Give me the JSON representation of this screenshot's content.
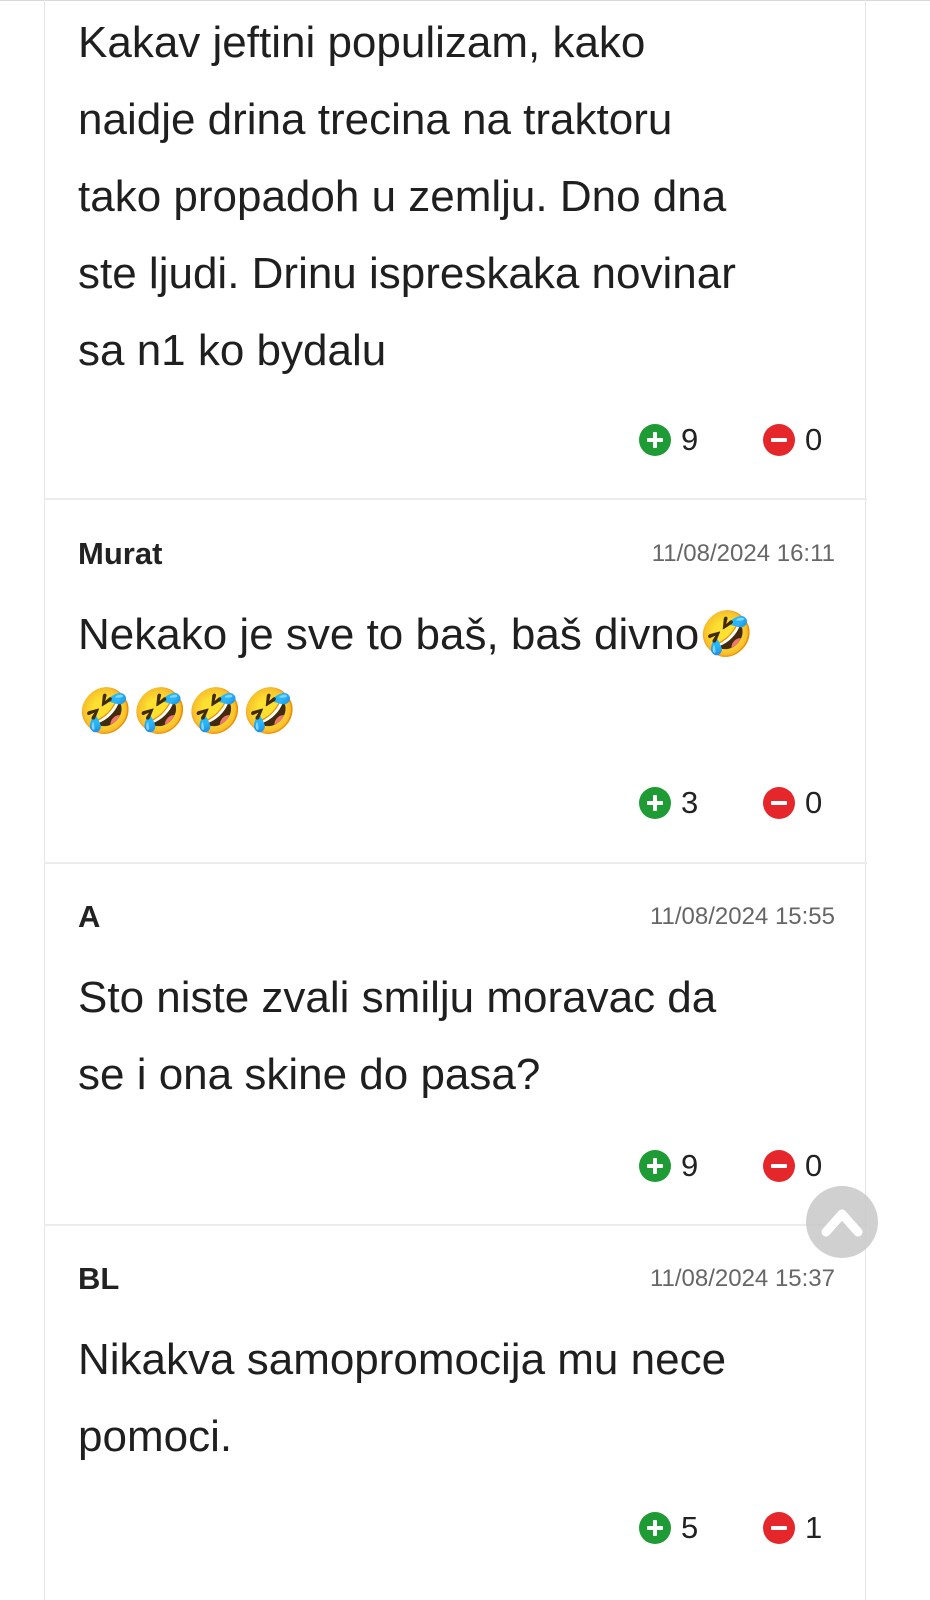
{
  "comments": [
    {
      "author": "",
      "date": "",
      "lines": [
        "Kakav jeftini populizam, kako",
        "naidje drina trecina na traktoru",
        "tako propadoh u zemlju. Dno dna",
        "ste ljudi. Drinu ispreskaka novinar",
        "sa n1 ko bydalu"
      ],
      "upvotes": "9",
      "downvotes": "0"
    },
    {
      "author": "Murat",
      "date": "11/08/2024 16:11",
      "lines": [
        "Nekako je sve to baš, baš divno🤣",
        "🤣🤣🤣🤣"
      ],
      "upvotes": "3",
      "downvotes": "0"
    },
    {
      "author": "A",
      "date": "11/08/2024 15:55",
      "lines": [
        "Sto niste zvali smilju moravac da",
        "se i ona skine do pasa?"
      ],
      "upvotes": "9",
      "downvotes": "0"
    },
    {
      "author": "BL",
      "date": "11/08/2024 15:37",
      "lines": [
        "Nikakva samopromocija mu nece",
        "pomoci."
      ],
      "upvotes": "5",
      "downvotes": "1"
    }
  ],
  "colors": {
    "upvote": "#1e9b35",
    "downvote": "#e5272b",
    "scroll_top_button": "#c8c8c8"
  },
  "icons": {
    "upvote": "plus-circle-icon",
    "downvote": "minus-circle-icon",
    "scroll_top": "chevron-up-icon"
  }
}
